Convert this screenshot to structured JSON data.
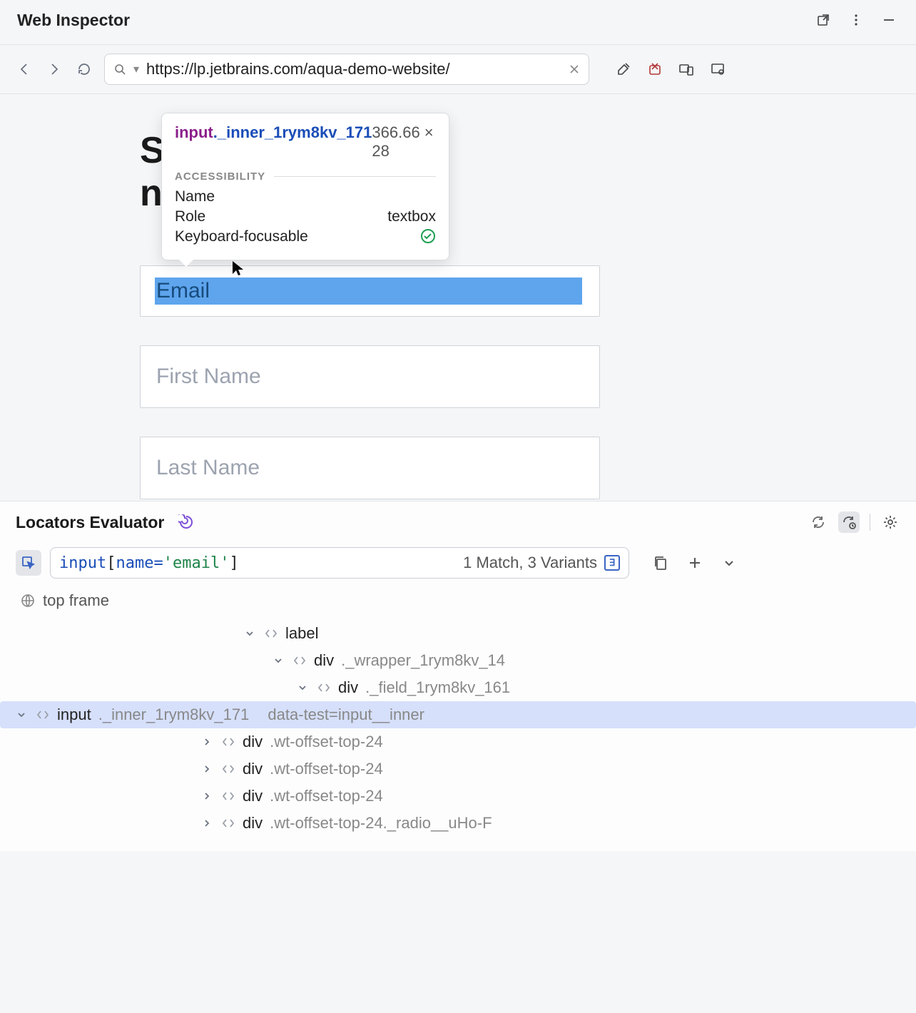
{
  "header": {
    "title": "Web Inspector"
  },
  "toolbar": {
    "url": "https://lp.jetbrains.com/aqua-demo-website/"
  },
  "viewport": {
    "heading_line1": "S",
    "heading_line2": "n",
    "tooltip": {
      "selector_tag": "input",
      "selector_class": "._inner_1rym8kv_171",
      "dimensions": "366.66 × 28",
      "section": "ACCESSIBILITY",
      "rows": {
        "name_label": "Name",
        "name_value": "",
        "role_label": "Role",
        "role_value": "textbox",
        "focus_label": "Keyboard-focusable"
      }
    },
    "fields": {
      "email": "Email",
      "first_name": "First Name",
      "last_name": "Last Name"
    }
  },
  "panel": {
    "title": "Locators Evaluator",
    "locator": {
      "tag": "input",
      "lbracket": "[",
      "attr": "name=",
      "str": "'email'",
      "rbracket": "]"
    },
    "match_text": "1 Match, 3 Variants",
    "css_badge": "∃",
    "frame_label": "top frame",
    "tree": [
      {
        "indent": "indent-1",
        "chev": "down",
        "tag": "label",
        "cls": "",
        "attr": ""
      },
      {
        "indent": "indent-2",
        "chev": "down",
        "tag": "div",
        "cls": "._wrapper_1rym8kv_14",
        "attr": ""
      },
      {
        "indent": "indent-3",
        "chev": "down",
        "tag": "div",
        "cls": "._field_1rym8kv_161",
        "attr": ""
      },
      {
        "indent": "indent-4",
        "chev": "down",
        "tag": "input",
        "cls": "._inner_1rym8kv_171",
        "attr": "data-test=input__inner",
        "selected": true
      },
      {
        "indent": "indent-0b",
        "chev": "right",
        "tag": "div",
        "cls": ".wt-offset-top-24",
        "attr": ""
      },
      {
        "indent": "indent-0b",
        "chev": "right",
        "tag": "div",
        "cls": ".wt-offset-top-24",
        "attr": ""
      },
      {
        "indent": "indent-0b",
        "chev": "right",
        "tag": "div",
        "cls": ".wt-offset-top-24",
        "attr": ""
      },
      {
        "indent": "indent-0b",
        "chev": "right",
        "tag": "div",
        "cls": ".wt-offset-top-24._radio__uHo-F",
        "attr": ""
      }
    ]
  }
}
